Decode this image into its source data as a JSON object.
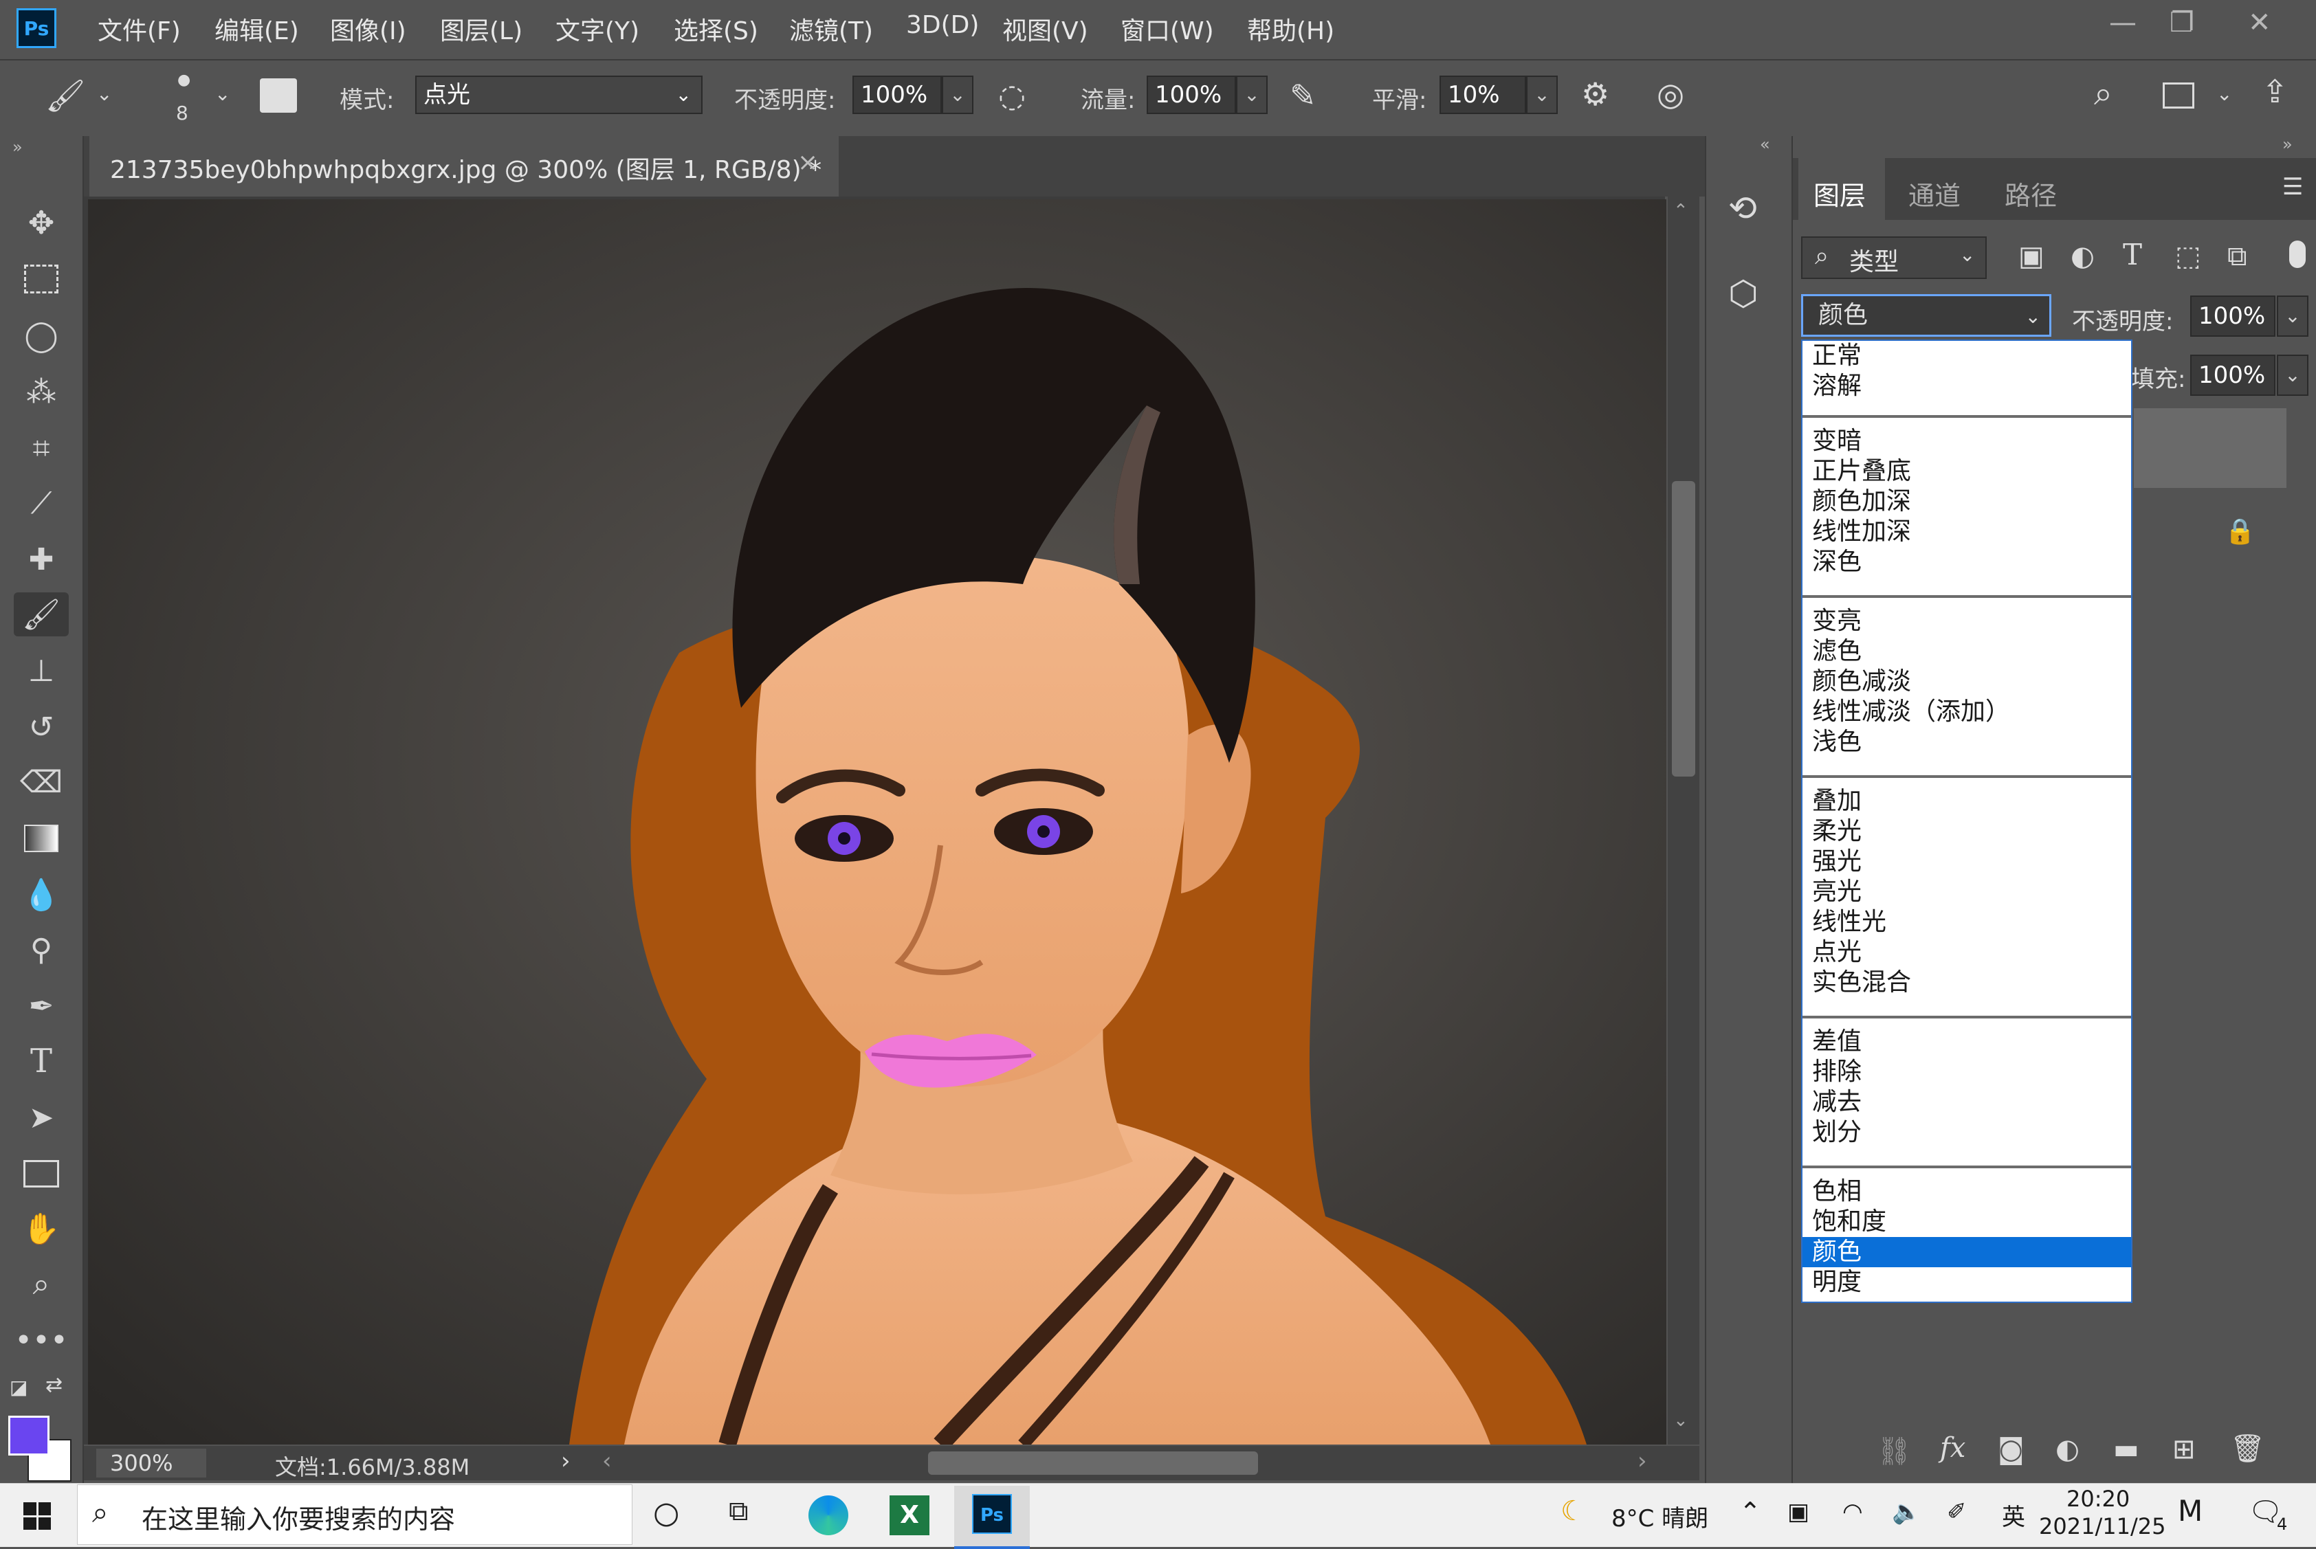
{
  "app": {
    "logo": "Ps"
  },
  "menu": [
    "文件(F)",
    "编辑(E)",
    "图像(I)",
    "图层(L)",
    "文字(Y)",
    "选择(S)",
    "滤镜(T)",
    "3D(D)",
    "视图(V)",
    "窗口(W)",
    "帮助(H)"
  ],
  "window_controls": {
    "minimize": "minimize-icon",
    "restore": "restore-icon",
    "close": "close-icon"
  },
  "options": {
    "brush_size": "8",
    "mode_label": "模式:",
    "mode_value": "点光",
    "opacity_label": "不透明度:",
    "opacity_value": "100%",
    "flow_label": "流量:",
    "flow_value": "100%",
    "smooth_label": "平滑:",
    "smooth_value": "10%"
  },
  "document": {
    "tab_title": "213735bey0bhpwhpqbxgrx.jpg @ 300% (图层 1, RGB/8) *",
    "zoom": "300%",
    "info": "文档:1.66M/3.88M"
  },
  "colors": {
    "foreground": "#6a45f0",
    "background": "#ffffff",
    "accent_selected": "#0a6fd8"
  },
  "panel": {
    "tabs": [
      "图层",
      "通道",
      "路径"
    ],
    "filter_label": "类型",
    "blend_mode": "颜色",
    "opacity_label": "不透明度:",
    "opacity_value": "100%",
    "fill_label": "填充:",
    "fill_value": "100%"
  },
  "blend_groups": [
    [
      "正常",
      "溶解"
    ],
    [
      "变暗",
      "正片叠底",
      "颜色加深",
      "线性加深",
      "深色"
    ],
    [
      "变亮",
      "滤色",
      "颜色减淡",
      "线性减淡（添加）",
      "浅色"
    ],
    [
      "叠加",
      "柔光",
      "强光",
      "亮光",
      "线性光",
      "点光",
      "实色混合"
    ],
    [
      "差值",
      "排除",
      "减去",
      "划分"
    ],
    [
      "色相",
      "饱和度",
      "颜色",
      "明度"
    ]
  ],
  "taskbar": {
    "search_placeholder": "在这里输入你要搜索的内容",
    "weather": "8°C 晴朗",
    "ime": "英",
    "time": "20:20",
    "date": "2021/11/25",
    "notifications": "4"
  }
}
